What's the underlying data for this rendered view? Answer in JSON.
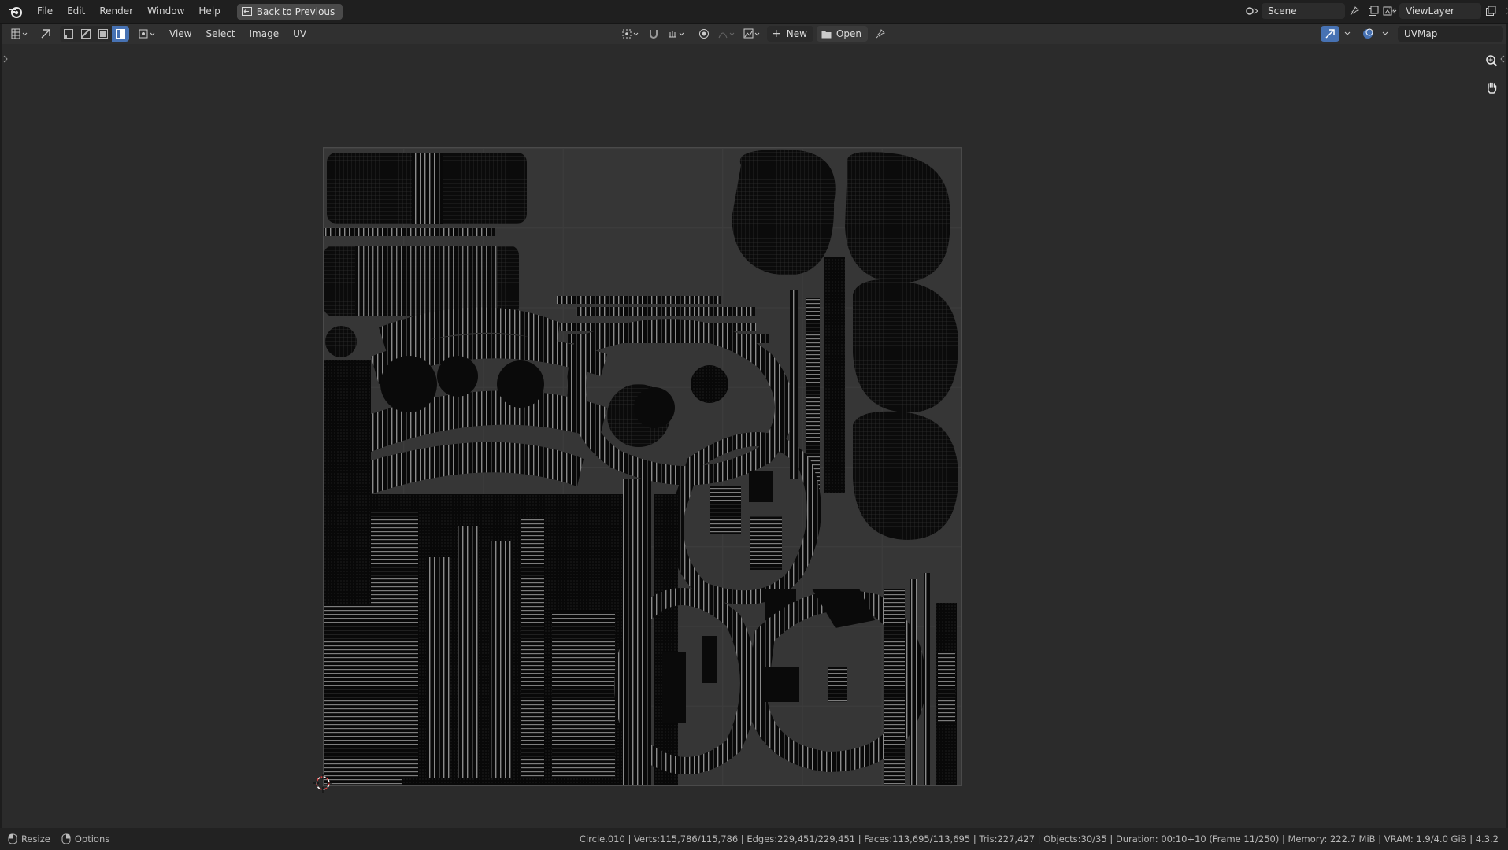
{
  "menubar": {
    "items": [
      "File",
      "Edit",
      "Render",
      "Window",
      "Help"
    ],
    "back_button": "Back to Previous",
    "scene": "Scene",
    "view_layer": "ViewLayer"
  },
  "editor_header": {
    "menus": [
      "View",
      "Select",
      "Image",
      "UV"
    ],
    "new_label": "New",
    "open_label": "Open",
    "uv_map": "UVMap"
  },
  "statusbar": {
    "resize_label": "Resize",
    "options_label": "Options",
    "stats": "Circle.010 | Verts:115,786/115,786 | Edges:229,451/229,451 | Faces:113,695/113,695 | Tris:227,427 | Objects:30/35 | Duration: 00:10+10 (Frame 11/250) | Memory: 222.7 MiB | VRAM: 1.9/4.0 GiB | 4.3.2"
  },
  "colors": {
    "accent": "#4772b3",
    "background": "#2b2b2b",
    "uv_tile": "#363636",
    "uv_islands": "#0b0b0b",
    "cursor": "#e04040"
  },
  "icons": {
    "blender_logo": "blender-logo-icon",
    "zoom": "zoom-icon",
    "pan": "hand-icon"
  }
}
